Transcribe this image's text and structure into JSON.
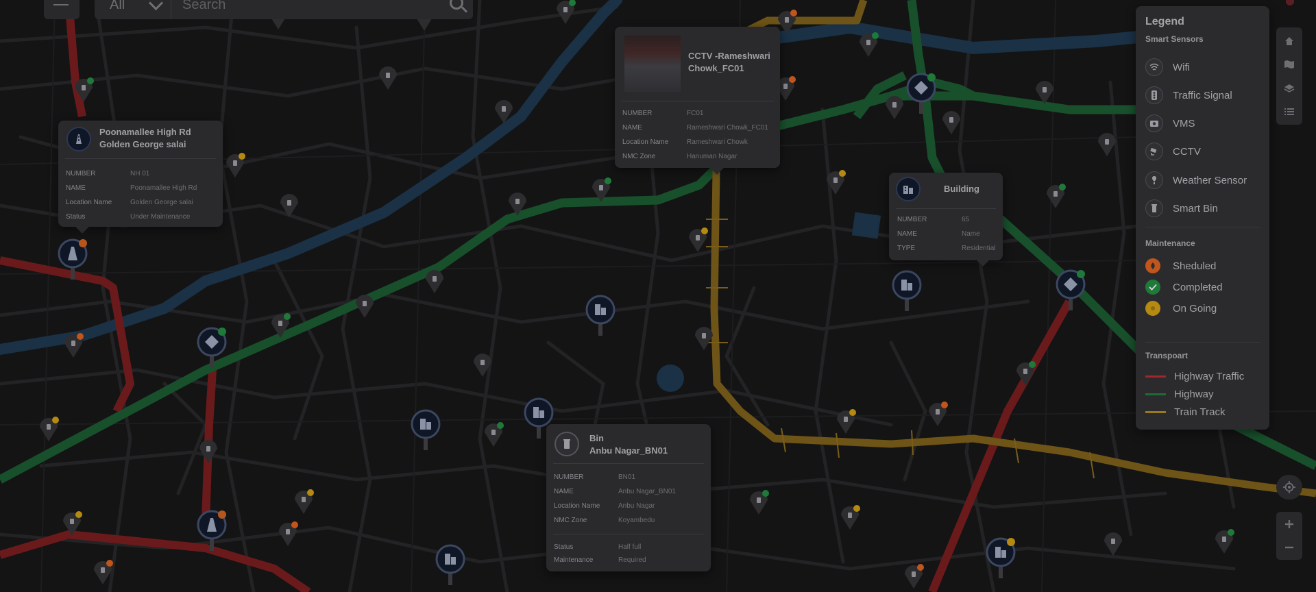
{
  "search": {
    "filter_value": "All",
    "placeholder": "Search"
  },
  "popups": {
    "highway": {
      "title_line1": "Poonamallee High Rd",
      "title_line2": "Golden George salai",
      "rows": [
        {
          "label": "NUMBER",
          "value": "NH 01"
        },
        {
          "label": "NAME",
          "value": "Poonamallee High Rd"
        },
        {
          "label": "Location Name",
          "value": "Golden George salai"
        },
        {
          "label": "Status",
          "value": "Under Maintenance"
        }
      ]
    },
    "cctv": {
      "title_line1": "CCTV -Rameshwari",
      "title_line2": "Chowk_FC01",
      "rows": [
        {
          "label": "NUMBER",
          "value": "FC01"
        },
        {
          "label": "NAME",
          "value": "Rameshwari Chowk_FC01"
        },
        {
          "label": "Location Name",
          "value": "Rameshwari Chowk"
        },
        {
          "label": "NMC Zone",
          "value": "Hanuman Nagar"
        }
      ]
    },
    "building": {
      "title": "Building",
      "rows": [
        {
          "label": "NUMBER",
          "value": "65"
        },
        {
          "label": "NAME",
          "value": "Name"
        },
        {
          "label": "TYPE",
          "value": "Residential"
        }
      ]
    },
    "bin": {
      "title_line1": "Bin",
      "title_line2": "Anbu Nagar_BN01",
      "rows": [
        {
          "label": "NUMBER",
          "value": "BN01"
        },
        {
          "label": "NAME",
          "value": "Anbu Nagar_BN01"
        },
        {
          "label": "Location Name",
          "value": "Anbu Nagar"
        },
        {
          "label": "NMC Zone",
          "value": "Koyambedu"
        }
      ],
      "status_rows": [
        {
          "label": "Status",
          "value": "Half full"
        },
        {
          "label": "Maintenance",
          "value": "Required"
        }
      ]
    }
  },
  "legend": {
    "title": "Legend",
    "sensors_heading": "Smart Sensors",
    "sensors": [
      {
        "label": "Wifi",
        "icon": "wifi-icon"
      },
      {
        "label": "Traffic Signal",
        "icon": "traffic-signal-icon"
      },
      {
        "label": "VMS",
        "icon": "vms-icon"
      },
      {
        "label": "CCTV",
        "icon": "cctv-icon"
      },
      {
        "label": "Weather Sensor",
        "icon": "weather-sensor-icon"
      },
      {
        "label": "Smart Bin",
        "icon": "smart-bin-icon"
      }
    ],
    "maintenance_heading": "Maintenance",
    "maintenance": [
      {
        "label": "Sheduled",
        "color": "#c0561c"
      },
      {
        "label": "Completed",
        "color": "#1f7a3a"
      },
      {
        "label": "On Going",
        "color": "#b58a12"
      }
    ],
    "transport_heading": "Transpoart",
    "transport": [
      {
        "label": "Highway Traffic",
        "color": "#a3262a"
      },
      {
        "label": "Highway",
        "color": "#1f6b3a"
      },
      {
        "label": "Train Track",
        "color": "#9a7a1a"
      }
    ]
  },
  "colors": {
    "highway_traffic": "#6b1a1c",
    "highway": "#18502c",
    "train_track": "#6e5416",
    "water": "#1a3146",
    "marker_dark": "#0f1626"
  }
}
